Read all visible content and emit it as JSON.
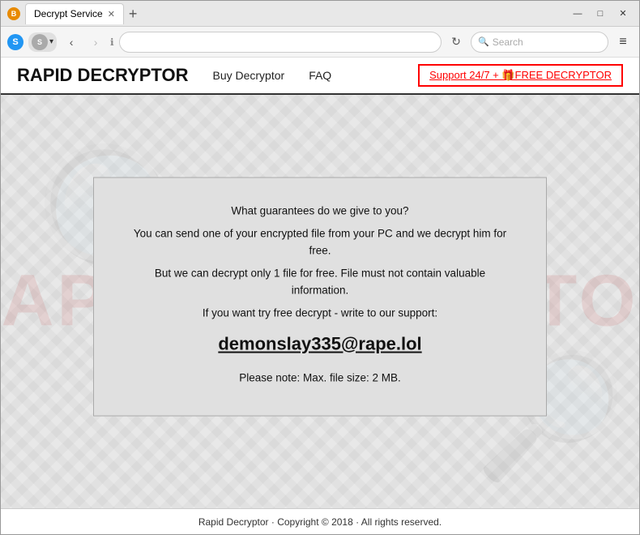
{
  "browser": {
    "tab_title": "Decrypt Service",
    "tab_icon": "B",
    "window_controls": {
      "minimize": "—",
      "maximize": "□",
      "close": "✕"
    },
    "nav": {
      "back": "‹",
      "forward": "›",
      "refresh": "↻",
      "shield_label": "S",
      "info_icon": "ℹ",
      "menu_icon": "≡"
    },
    "search_placeholder": "Search"
  },
  "site": {
    "title": "RAPID DECRYPTOR",
    "nav_links": [
      {
        "label": "Buy Decryptor"
      },
      {
        "label": "FAQ"
      }
    ],
    "free_btn_label": "Support 24/7 + 🎁FREE DECRYPTOR",
    "watermark_text": "RAPID DECRYPTOR",
    "content": {
      "para1": "What guarantees do we give to you?",
      "para2": "You can send one of your encrypted file from your PC and we decrypt him for free.",
      "para3": "But we can decrypt only 1 file for free. File must not contain valuable information.",
      "para4": "If you want try free decrypt - write to our support:",
      "email": "demonslay335@rape.lol",
      "note": "Please note: Max. file size: 2 MB."
    },
    "footer": "Rapid Decryptor · Copyright © 2018 · All rights reserved."
  }
}
